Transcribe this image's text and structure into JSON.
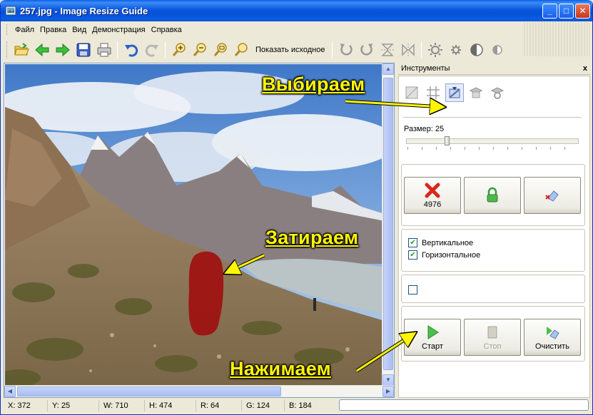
{
  "window": {
    "title": "257.jpg - Image Resize Guide",
    "controls": {
      "minimize": "_",
      "maximize": "□",
      "close": "✕"
    }
  },
  "menu": [
    "Файл",
    "Правка",
    "Вид",
    "Демонстрация",
    "Справка"
  ],
  "toolbar": {
    "icons": [
      "open-folder-icon",
      "back-arrow-icon",
      "forward-arrow-icon",
      "save-icon",
      "print-icon",
      "undo-icon",
      "redo-icon",
      "zoom-in-icon",
      "zoom-out-icon",
      "zoom-fit-icon",
      "zoom-actual-icon",
      "rotate-left-icon",
      "rotate-right-icon",
      "flip-vertical-icon",
      "flip-horizontal-icon",
      "brightness-icon",
      "settings-icon",
      "contrast-icon",
      "half-tone-icon"
    ],
    "show_original": "Показать исходное"
  },
  "panel": {
    "title": "Инструменты",
    "close": "x",
    "modes": [
      "crop-icon",
      "grid-icon",
      "eraser-mode-icon",
      "hat-mode-icon",
      "gear-hat-icon"
    ],
    "size_label": "Размер: 25",
    "size_value": 25,
    "counter_value": "4976",
    "checkbox_vertical": "Вертикальное",
    "checkbox_horizontal": "Горизонтальное",
    "vertical_checked": true,
    "horizontal_checked": true,
    "extra_checked": false,
    "start_label": "Старт",
    "stop_label": "Стоп",
    "clear_label": "Очистить"
  },
  "status": {
    "x": "X: 372",
    "y": "Y: 25",
    "w": "W: 710",
    "h": "H: 474",
    "r": "R: 64",
    "g": "G: 124",
    "b": "B: 184"
  },
  "annotations": {
    "select": "Выбираем",
    "erase": "Затираем",
    "press": "Нажимаем"
  },
  "colors": {
    "annotation": "#fff600",
    "mask": "#a01010",
    "title_bar": "#0a58de"
  }
}
